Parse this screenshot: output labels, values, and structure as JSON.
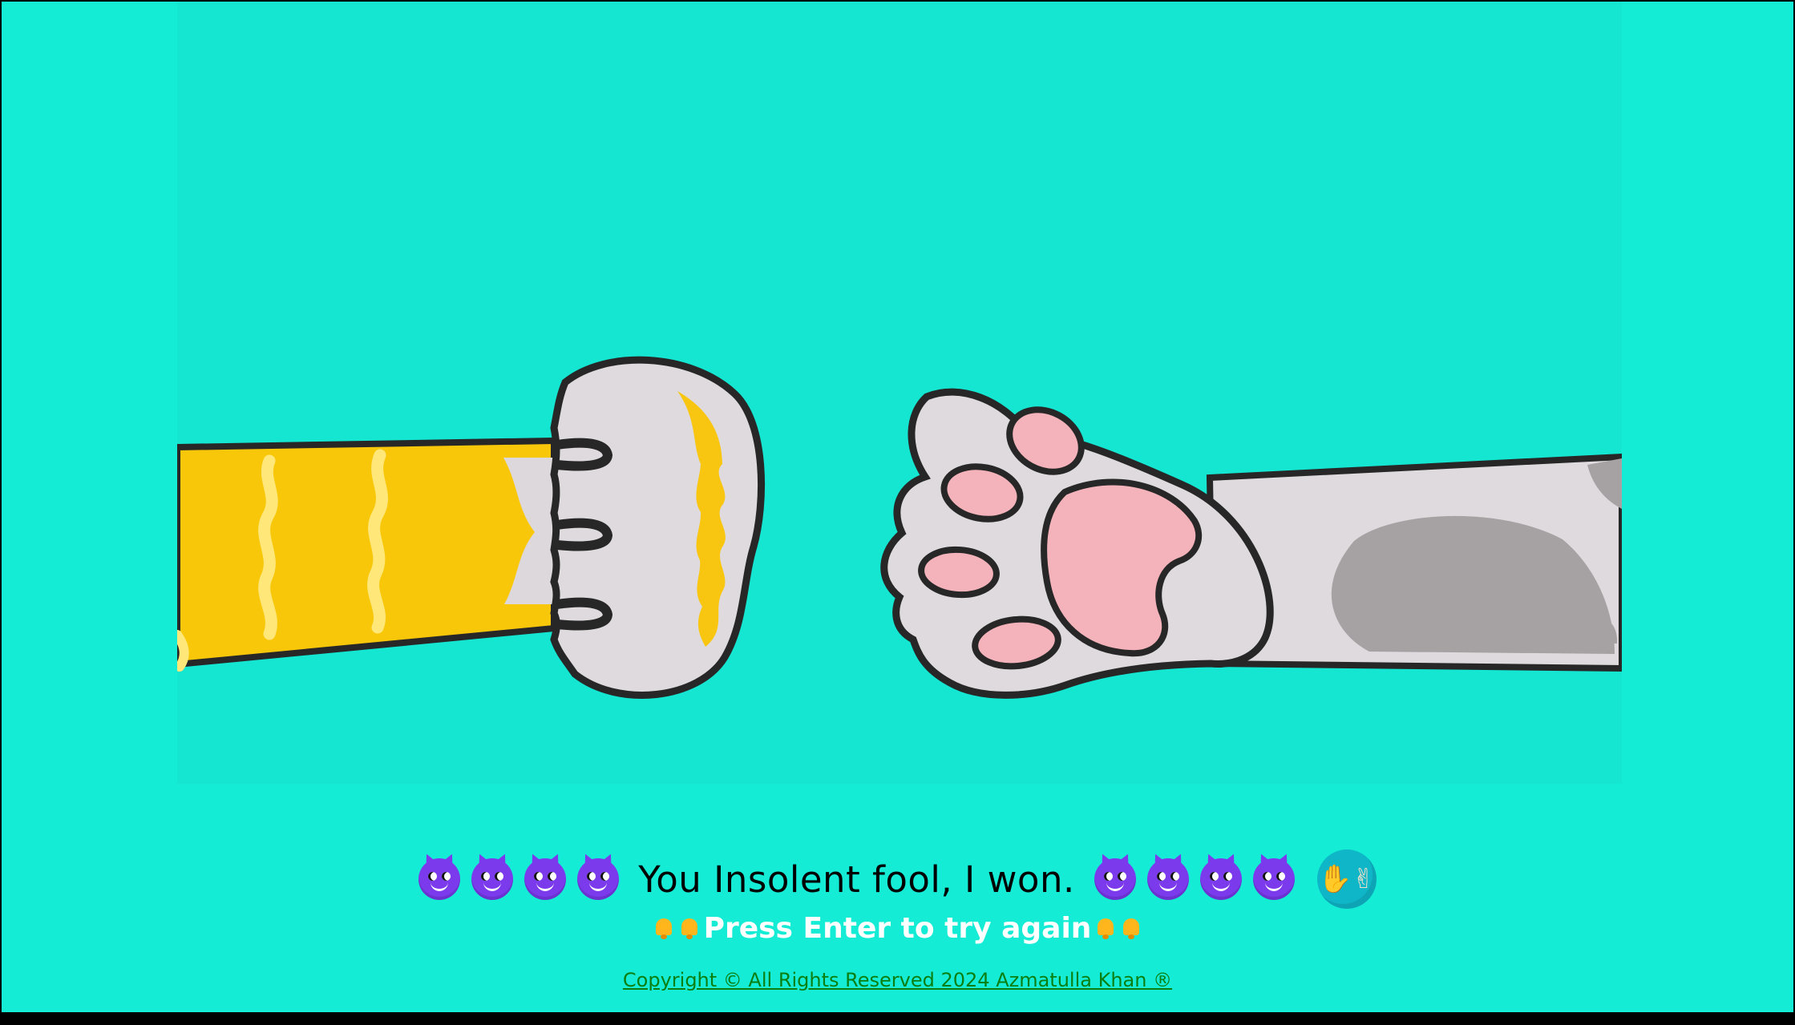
{
  "game": {
    "result_text": "You Insolent fool, I won.",
    "instruction_text": "Press Enter to try again",
    "copyright_text": "Copyright © All Rights Reserved 2024 Azmatulla Khan ®",
    "emoji_left_count": 4,
    "emoji_right_count": 4,
    "emoji_name": "smiling-face-with-horns",
    "hand_icon_name": "rock-paper-scissors-hands-icon",
    "bell_icon_name": "bell-icon"
  },
  "colors": {
    "background": "#14ecd6",
    "image_background": "#14e6d2",
    "text_primary": "#000000",
    "text_secondary": "#ffffff",
    "link": "#0b7f10",
    "emoji_purple": "#7c3aed",
    "bell_yellow": "#ffb51c",
    "hand_circle": "#0fb6c7"
  }
}
